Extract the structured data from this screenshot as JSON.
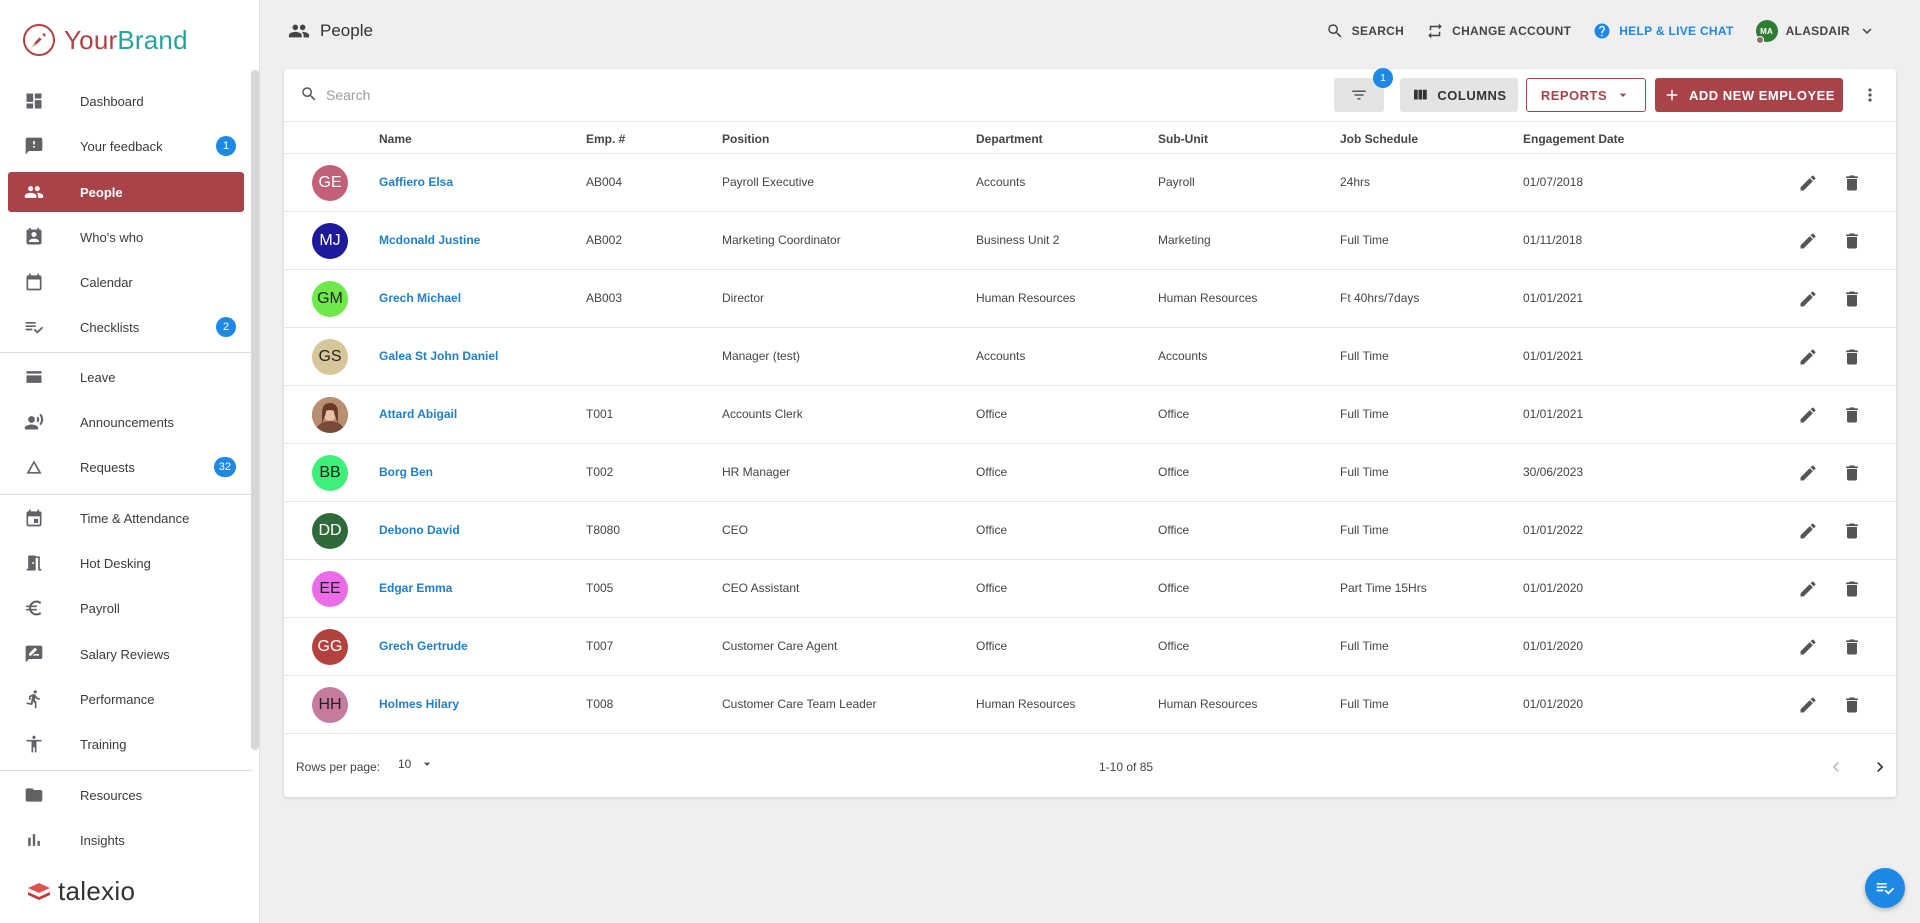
{
  "brand": {
    "part1": "Your",
    "part2": "Brand"
  },
  "footer_brand": "talexio",
  "page_title": "People",
  "sidebar": {
    "items": [
      {
        "label": "Dashboard",
        "icon": "dashboard-icon",
        "badge": ""
      },
      {
        "label": "Your feedback",
        "icon": "feedback-icon",
        "badge": "1"
      },
      {
        "label": "People",
        "icon": "people-icon",
        "badge": "",
        "active": true
      },
      {
        "label": "Who's who",
        "icon": "contact-card-icon",
        "badge": ""
      },
      {
        "label": "Calendar",
        "icon": "calendar-icon",
        "badge": ""
      },
      {
        "label": "Checklists",
        "icon": "checklist-icon",
        "badge": "2"
      },
      {
        "label": "Leave",
        "icon": "leave-icon",
        "badge": ""
      },
      {
        "label": "Announcements",
        "icon": "announcement-icon",
        "badge": ""
      },
      {
        "label": "Requests",
        "icon": "requests-icon",
        "badge": "32"
      },
      {
        "label": "Time & Attendance",
        "icon": "time-attendance-icon",
        "badge": ""
      },
      {
        "label": "Hot Desking",
        "icon": "hot-desk-icon",
        "badge": ""
      },
      {
        "label": "Payroll",
        "icon": "euro-icon",
        "badge": ""
      },
      {
        "label": "Salary Reviews",
        "icon": "salary-review-icon",
        "badge": ""
      },
      {
        "label": "Performance",
        "icon": "performance-icon",
        "badge": ""
      },
      {
        "label": "Training",
        "icon": "training-icon",
        "badge": ""
      },
      {
        "label": "Resources",
        "icon": "folder-icon",
        "badge": ""
      },
      {
        "label": "Insights",
        "icon": "bar-chart-icon",
        "badge": ""
      }
    ]
  },
  "topbar": {
    "search": "SEARCH",
    "change_account": "CHANGE ACCOUNT",
    "help": "HELP & LIVE CHAT",
    "user_initials": "MA",
    "user_name": "ALASDAIR"
  },
  "toolbar": {
    "search_placeholder": "Search",
    "filter_count": "1",
    "columns_label": "COLUMNS",
    "reports_label": "REPORTS",
    "add_label": "ADD NEW EMPLOYEE"
  },
  "table": {
    "headers": [
      "Name",
      "Emp. #",
      "Position",
      "Department",
      "Sub-Unit",
      "Job Schedule",
      "Engagement Date"
    ],
    "rows": [
      {
        "initials": "GE",
        "color": "#c2607a",
        "dark": false,
        "name": "Gaffiero Elsa",
        "emp": "AB004",
        "position": "Payroll Executive",
        "department": "Accounts",
        "subunit": "Payroll",
        "schedule": "24hrs",
        "date": "01/07/2018"
      },
      {
        "initials": "MJ",
        "color": "#1e1a9c",
        "dark": false,
        "name": "Mcdonald Justine",
        "emp": "AB002",
        "position": "Marketing Coordinator",
        "department": "Business Unit 2",
        "subunit": "Marketing",
        "schedule": "Full Time",
        "date": "01/11/2018"
      },
      {
        "initials": "GM",
        "color": "#6ee84a",
        "dark": true,
        "name": "Grech Michael",
        "emp": "AB003",
        "position": "Director",
        "department": "Human Resources",
        "subunit": "Human Resources",
        "schedule": "Ft 40hrs/7days",
        "date": "01/01/2021"
      },
      {
        "initials": "GS",
        "color": "#d6c79a",
        "dark": true,
        "name": "Galea St John Daniel",
        "emp": "",
        "position": "Manager (test)",
        "department": "Accounts",
        "subunit": "Accounts",
        "schedule": "Full Time",
        "date": "01/01/2021"
      },
      {
        "initials": "",
        "color": "#8a5a44",
        "dark": false,
        "photo": true,
        "name": "Attard Abigail",
        "emp": "T001",
        "position": "Accounts Clerk",
        "department": "Office",
        "subunit": "Office",
        "schedule": "Full Time",
        "date": "01/01/2021"
      },
      {
        "initials": "BB",
        "color": "#3ef07a",
        "dark": true,
        "name": " Borg Ben",
        "emp": "T002",
        "position": "HR Manager",
        "department": "Office",
        "subunit": "Office",
        "schedule": "Full Time",
        "date": "30/06/2023"
      },
      {
        "initials": "DD",
        "color": "#2f6b3a",
        "dark": false,
        "name": "Debono David",
        "emp": "T8080",
        "position": "CEO",
        "department": "Office",
        "subunit": "Office",
        "schedule": "Full Time",
        "date": "01/01/2022"
      },
      {
        "initials": "EE",
        "color": "#ea6ce8",
        "dark": true,
        "name": "Edgar Emma",
        "emp": "T005",
        "position": "CEO Assistant",
        "department": "Office",
        "subunit": "Office",
        "schedule": "Part Time 15Hrs",
        "date": "01/01/2020"
      },
      {
        "initials": "GG",
        "color": "#b5413f",
        "dark": false,
        "name": "Grech Gertrude",
        "emp": "T007",
        "position": "Customer Care Agent",
        "department": "Office",
        "subunit": "Office",
        "schedule": "Full Time",
        "date": "01/01/2020"
      },
      {
        "initials": "HH",
        "color": "#c57a9e",
        "dark": true,
        "name": "Holmes Hilary",
        "emp": "T008",
        "position": "Customer Care Team Leader",
        "department": "Human Resources",
        "subunit": "Human Resources",
        "schedule": "Full Time",
        "date": "01/01/2020"
      }
    ]
  },
  "pagination": {
    "rows_per_page_label": "Rows per page:",
    "rows_per_page": "10",
    "info": "1-10 of 85"
  },
  "colors": {
    "accent": "#a8434a",
    "link": "#1f7fc9",
    "badge": "#1e88e5"
  }
}
